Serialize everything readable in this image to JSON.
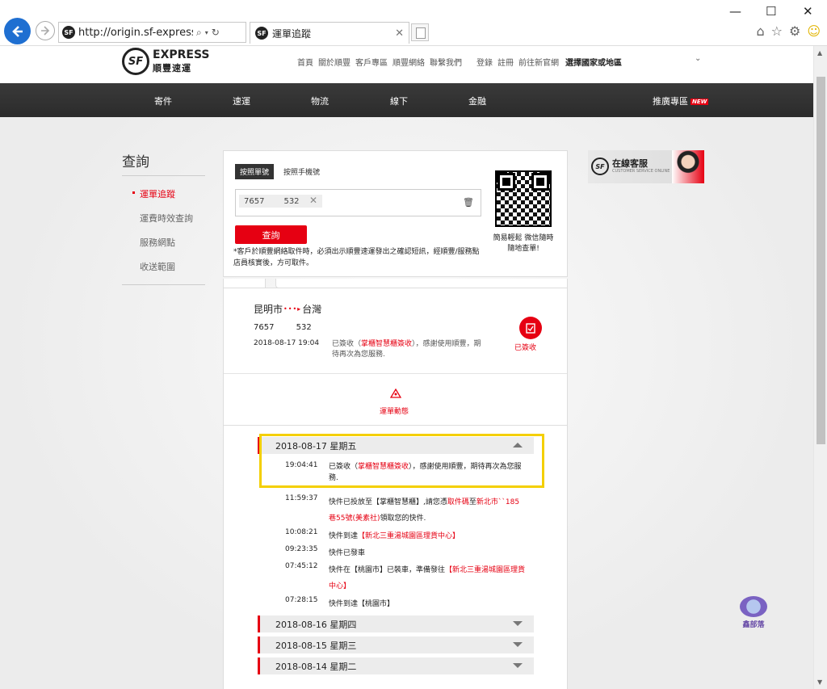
{
  "browser": {
    "url": "http://origin.sf-express.c",
    "tab_title": "運單追蹤",
    "tab_close": "✕"
  },
  "site": {
    "logo_en": "EXPRESS",
    "logo_zh": "順豐速運",
    "logo_mark": "SF",
    "top_links": [
      "首頁",
      "關於順豐",
      "客戶專區",
      "順豐網絡",
      "聯繫我們"
    ],
    "account_links": [
      "登錄",
      "註冊",
      "前往新官網"
    ],
    "region": "選擇國家或地區",
    "nav": [
      "寄件",
      "速運",
      "物流",
      "線下",
      "金融"
    ],
    "nav_promo": "推廣專區",
    "nav_promo_badge": "NEW"
  },
  "sidebar": {
    "title": "查詢",
    "items": [
      "運單追蹤",
      "運費時效查詢",
      "服務網點",
      "收送範圍"
    ]
  },
  "query": {
    "tab_waybill": "按照單號",
    "tab_phone": "按照手機號",
    "number_part1": "7657",
    "number_part2": "532",
    "button": "查詢",
    "note": "*客戶於順豐網絡取件時，必須出示順豐速運發出之確認短訊，經順豐/服務點店員核實後，方可取件。",
    "qr_caption_1": "簡易輕鬆 微信隨時",
    "qr_caption_2": "隨地查單!"
  },
  "result": {
    "origin": "昆明市",
    "destination": "台灣",
    "number_part1": "7657",
    "number_part2": "532",
    "datetime": "2018-08-17 19:04",
    "status_prefix": "已簽收（",
    "status_highlight": "掌櫃智慧櫃簽收",
    "status_suffix": "），感謝使用順豐，期待再次為您服務.",
    "signed_label": "已簽收",
    "dynamics_label": "運單動態"
  },
  "timeline": {
    "days": [
      {
        "label": "2018-08-17 星期五",
        "expanded": true
      },
      {
        "label": "2018-08-16 星期四",
        "expanded": false
      },
      {
        "label": "2018-08-15 星期三",
        "expanded": false
      },
      {
        "label": "2018-08-14 星期二",
        "expanded": false
      }
    ],
    "events": [
      {
        "time": "19:04:41",
        "a": "已簽收（",
        "b": "掌櫃智慧櫃簽收",
        "c": "），感謝使用順豐，期待再次為您服務."
      },
      {
        "time": "11:59:37",
        "a": "快件已投放至【掌櫃智慧櫃】,請您憑",
        "b": "取件碼",
        "c": "至",
        "d": "新北市``185巷55號(美素社)",
        "e": "領取您的快件."
      },
      {
        "time": "10:08:21",
        "a": "快件到達",
        "b": "【新北三重湯城園區理貨中心】"
      },
      {
        "time": "09:23:35",
        "a": "快件已發車"
      },
      {
        "time": "07:45:12",
        "a": "快件在【桃園市】已裝車，準備發往",
        "b": "【新北三重湯城園區理貨中心】"
      },
      {
        "time": "07:28:15",
        "a": "快件到達【桃園市】"
      }
    ]
  },
  "customer_service": {
    "title": "在線客服",
    "subtitle": "CUSTOMER SERVICE ONLINE"
  },
  "watermark": "鑫部落",
  "colors": {
    "brand_red": "#e60012",
    "highlight": "#f4cf00",
    "nav_bg": "#2e2e2e"
  }
}
